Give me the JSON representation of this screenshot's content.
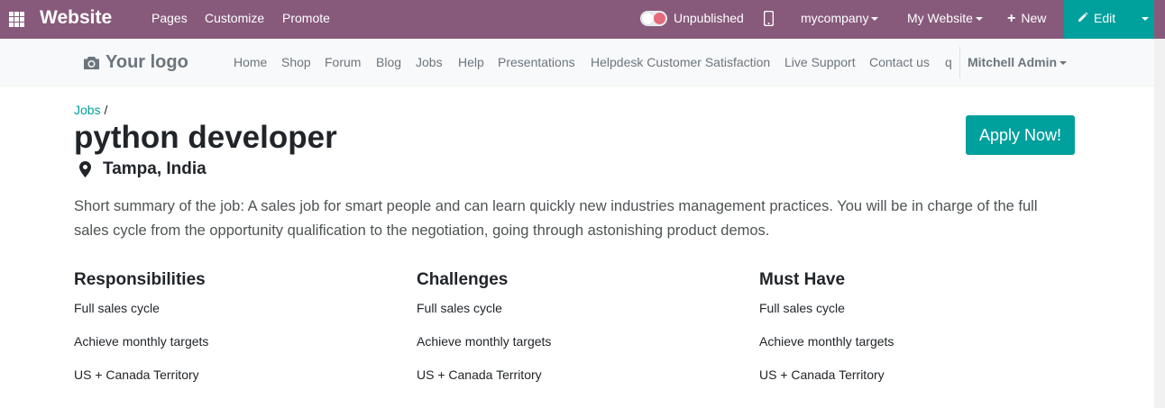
{
  "topbar": {
    "brand": "Website",
    "menus": [
      "Pages",
      "Customize",
      "Promote"
    ],
    "status_label": "Unpublished",
    "company_dropdown": "mycompany",
    "website_dropdown": "My Website",
    "new_label": "New",
    "edit_label": "Edit",
    "colors": {
      "bar": "#875a7b",
      "accent": "#00a09d"
    }
  },
  "navbar": {
    "logo_text": "Your logo",
    "links": [
      "Home",
      "Shop",
      "Forum",
      "Blog",
      "Jobs",
      "Help",
      "Presentations",
      "Helpdesk Customer Satisfaction",
      "Live Support",
      "Contact us",
      "q"
    ],
    "user": "Mitchell Admin"
  },
  "breadcrumb": {
    "parent": "Jobs",
    "separator": "/"
  },
  "job": {
    "title": "python developer",
    "location": "Tampa, India",
    "apply_label": "Apply Now!",
    "summary": "Short summary of the job: A sales job for smart people and can learn quickly new industries management practices. You will be in charge of the full sales cycle from the opportunity qualification to the negotiation, going through astonishing product demos."
  },
  "sections": [
    {
      "title": "Responsibilities",
      "items": [
        "Full sales cycle",
        "Achieve monthly targets",
        "US + Canada Territory"
      ]
    },
    {
      "title": "Challenges",
      "items": [
        "Full sales cycle",
        "Achieve monthly targets",
        "US + Canada Territory"
      ]
    },
    {
      "title": "Must Have",
      "items": [
        "Full sales cycle",
        "Achieve monthly targets",
        "US + Canada Territory"
      ]
    }
  ]
}
